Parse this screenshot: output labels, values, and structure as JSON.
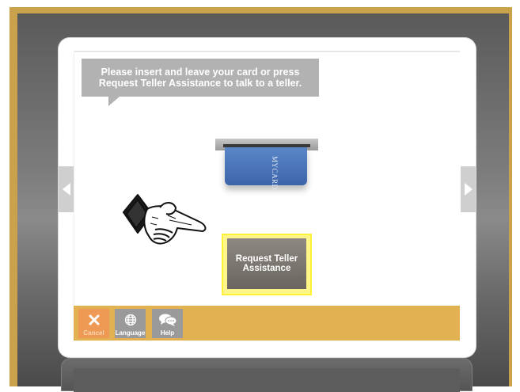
{
  "prompt": {
    "line1": "Please insert and leave your card or press",
    "line2": "Request Teller Assistance to talk to a teller."
  },
  "card": {
    "label": "MYCARD"
  },
  "teller_button": {
    "line1": "Request Teller",
    "line2": "Assistance"
  },
  "bottom_bar": {
    "cancel_label": "Cancel",
    "language_label": "Language",
    "help_label": "Help"
  },
  "icons": {
    "nav_left": "chevron-left-icon",
    "nav_right": "chevron-right-icon",
    "pointing_hand": "pointing-hand-icon",
    "cancel": "close-icon",
    "language": "globe-icon",
    "help": "chat-bubbles-icon"
  },
  "colors": {
    "frame": "#c9a24b",
    "bottom_bar": "#e2b252",
    "cancel": "#ee9a55",
    "teller_highlight": "#fff236",
    "card_blue": "#3d66aa"
  }
}
